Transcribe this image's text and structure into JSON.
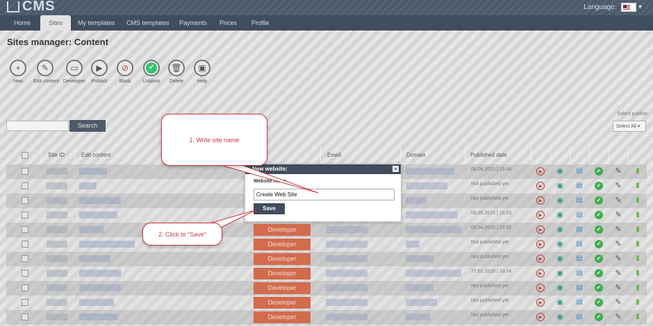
{
  "header": {
    "logo_text": "CMS",
    "language_label": "Language:"
  },
  "nav": {
    "items": [
      {
        "label": "Home"
      },
      {
        "label": "Sites"
      },
      {
        "label": "My templates"
      },
      {
        "label": "CMS templates"
      },
      {
        "label": "Payments"
      },
      {
        "label": "Prices"
      },
      {
        "label": "Profile"
      }
    ],
    "active": "Sites"
  },
  "page": {
    "title": "Sites manager: Content"
  },
  "toolbar": {
    "tools": [
      {
        "label": "New",
        "icon": "plus-icon"
      },
      {
        "label": "Edit content",
        "icon": "pencil-icon"
      },
      {
        "label": "Developer",
        "icon": "developer-icon"
      },
      {
        "label": "Publish",
        "icon": "play-icon"
      },
      {
        "label": "Block",
        "icon": "block-icon"
      },
      {
        "label": "Unblock",
        "icon": "check-icon"
      },
      {
        "label": "Delete",
        "icon": "trash-icon"
      },
      {
        "label": "Help",
        "icon": "help-icon"
      }
    ]
  },
  "search": {
    "button_label": "Search",
    "value": ""
  },
  "publish_filter": {
    "label": "Select publish",
    "selected": "Select All"
  },
  "table": {
    "headers": {
      "site_id": "Site ID",
      "edit_content": "Edit content",
      "email": "Email",
      "domain": "Domain",
      "published_date": "Published date"
    },
    "developer_label": "Developer",
    "rows": [
      {
        "published": "08.08.2015 | 15:34",
        "developer": false
      },
      {
        "published": "Not published yet",
        "developer": false
      },
      {
        "published": "Not published yet",
        "developer": false
      },
      {
        "published": "06.05.2015 | 15:33",
        "developer": false
      },
      {
        "published": "08.04.2015 | 10:32",
        "developer": true
      },
      {
        "published": "Not published yet",
        "developer": true
      },
      {
        "published": "Not published yet",
        "developer": true
      },
      {
        "published": "27.02.2015 | 10:24",
        "developer": true
      },
      {
        "published": "Not published yet",
        "developer": true
      },
      {
        "published": "Not published yet",
        "developer": true
      },
      {
        "published": "Not published yet",
        "developer": true
      }
    ]
  },
  "modal": {
    "title": "New website:",
    "field_label": "Website name",
    "input_value": "Create Web Site",
    "save_label": "Save"
  },
  "callouts": {
    "step1": "1. Write site name",
    "step2": "2. Click to \"Save\""
  },
  "colors": {
    "header_bg": "#4a5a6b",
    "developer_button": "#dc6b4a",
    "callout_text": "#d0383d"
  }
}
